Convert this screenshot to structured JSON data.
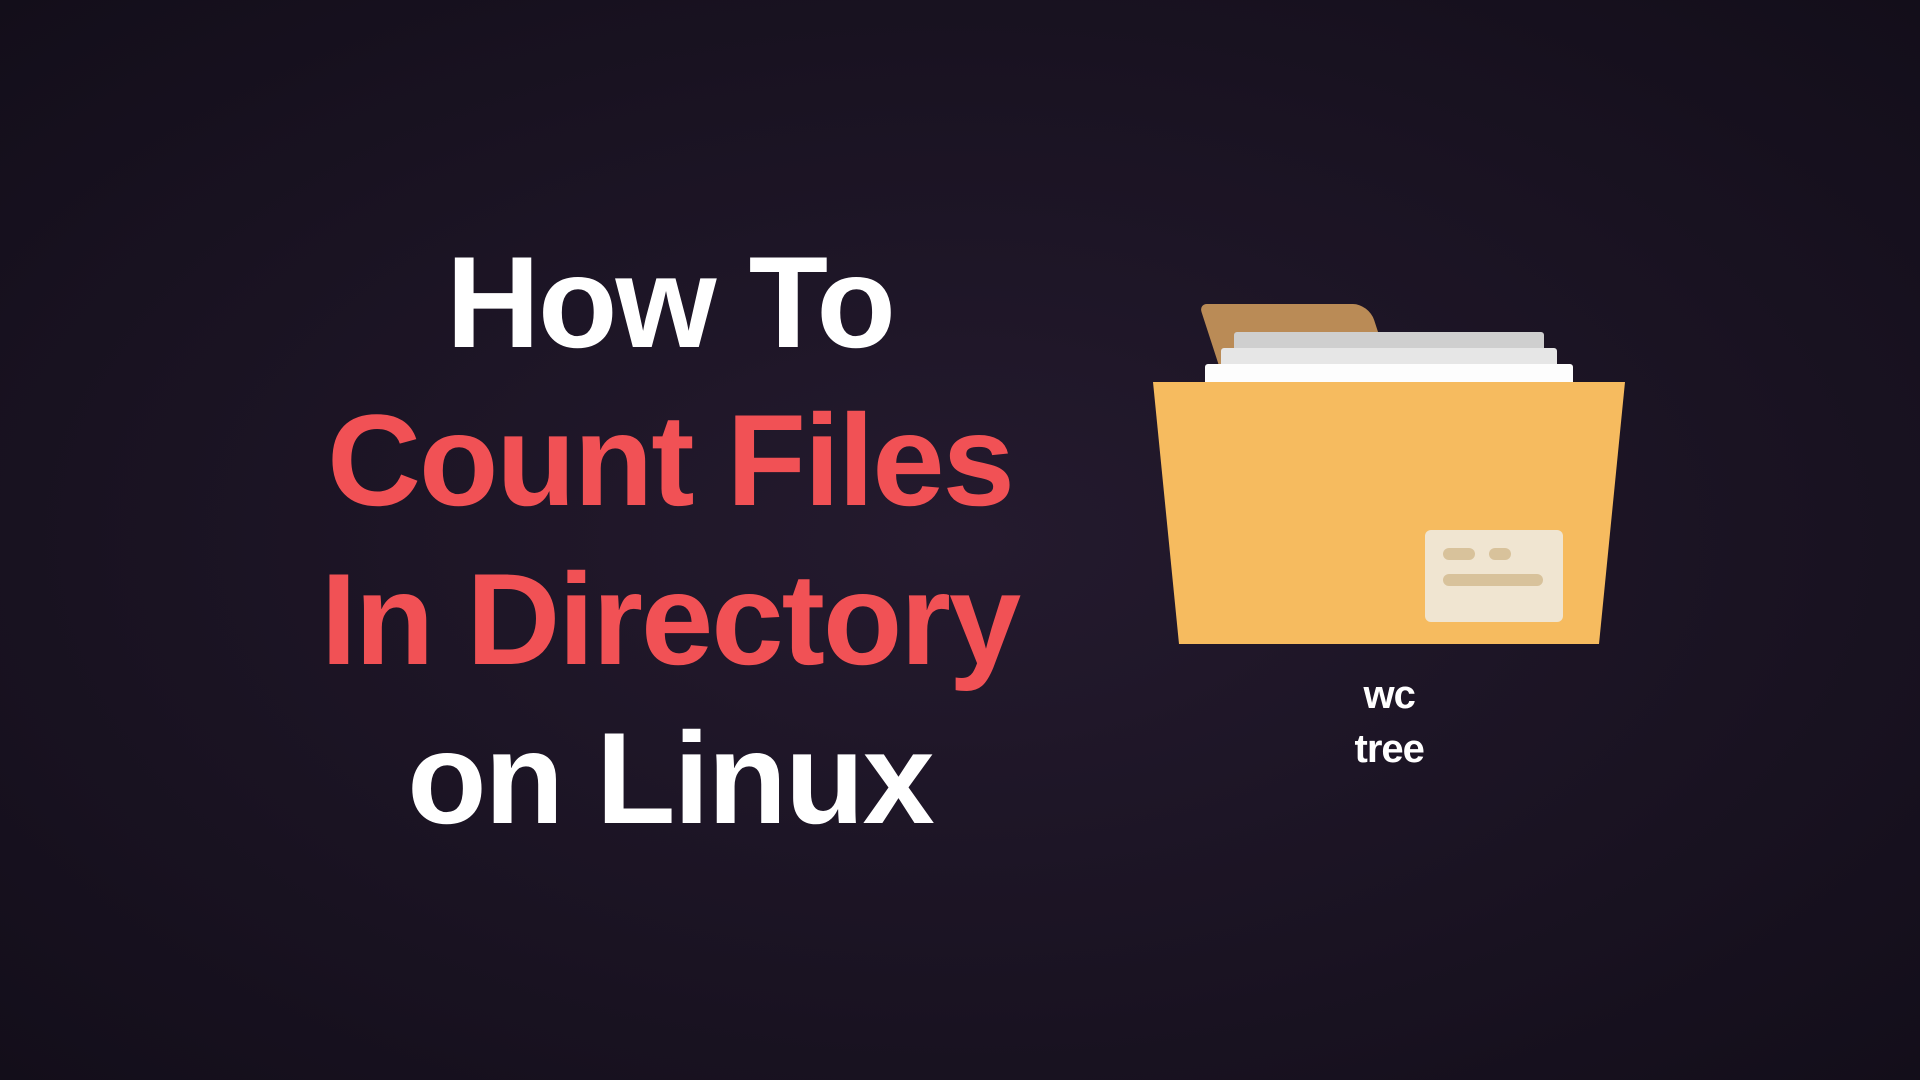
{
  "headline": {
    "line1": "How To",
    "line2": "Count Files",
    "line3": "In Directory",
    "line4": "on Linux"
  },
  "commands": {
    "cmd1": "wc",
    "cmd2": "tree"
  }
}
